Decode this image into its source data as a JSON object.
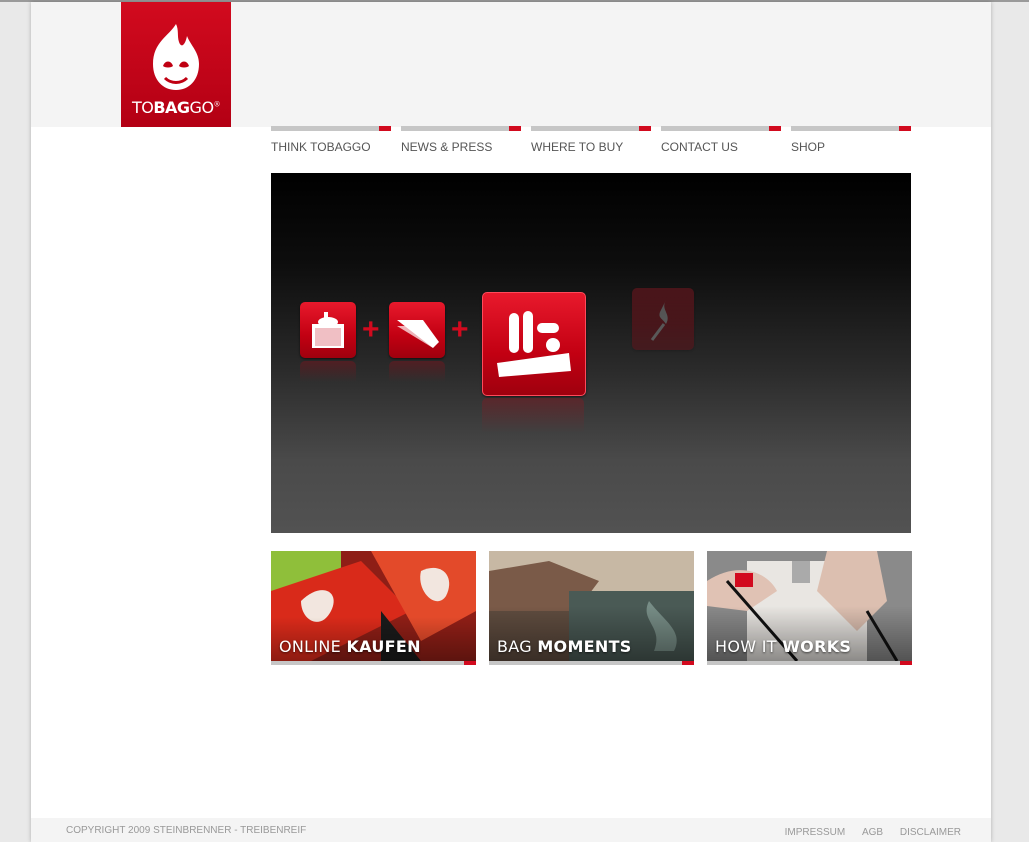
{
  "brand": {
    "logo_text_plain_1": "TO",
    "logo_text_bold": "BAG",
    "logo_text_plain_2": "GO",
    "registered": "®"
  },
  "nav": {
    "items": [
      {
        "label": "THINK TOBAGGO"
      },
      {
        "label": "NEWS & PRESS"
      },
      {
        "label": "WHERE TO BUY"
      },
      {
        "label": "CONTACT US"
      },
      {
        "label": "SHOP"
      }
    ]
  },
  "hero": {
    "icons": [
      "ashtray-icon",
      "paper-icon",
      "charcoal-bag-icon",
      "match-flame-icon"
    ]
  },
  "teasers": [
    {
      "light": "ONLINE ",
      "bold": "KAUFEN"
    },
    {
      "light": "BAG ",
      "bold": "MOMENTS"
    },
    {
      "light": "HOW IT ",
      "bold": "WORKS"
    }
  ],
  "footer": {
    "copyright": "COPYRIGHT 2009 STEINBRENNER - TREIBENREIF",
    "links": [
      "IMPRESSUM",
      "AGB",
      "DISCLAIMER"
    ]
  },
  "colors": {
    "accent": "#d20a1e",
    "nav_bar": "#c6c6c6",
    "header_bg": "#f4f4f4"
  }
}
